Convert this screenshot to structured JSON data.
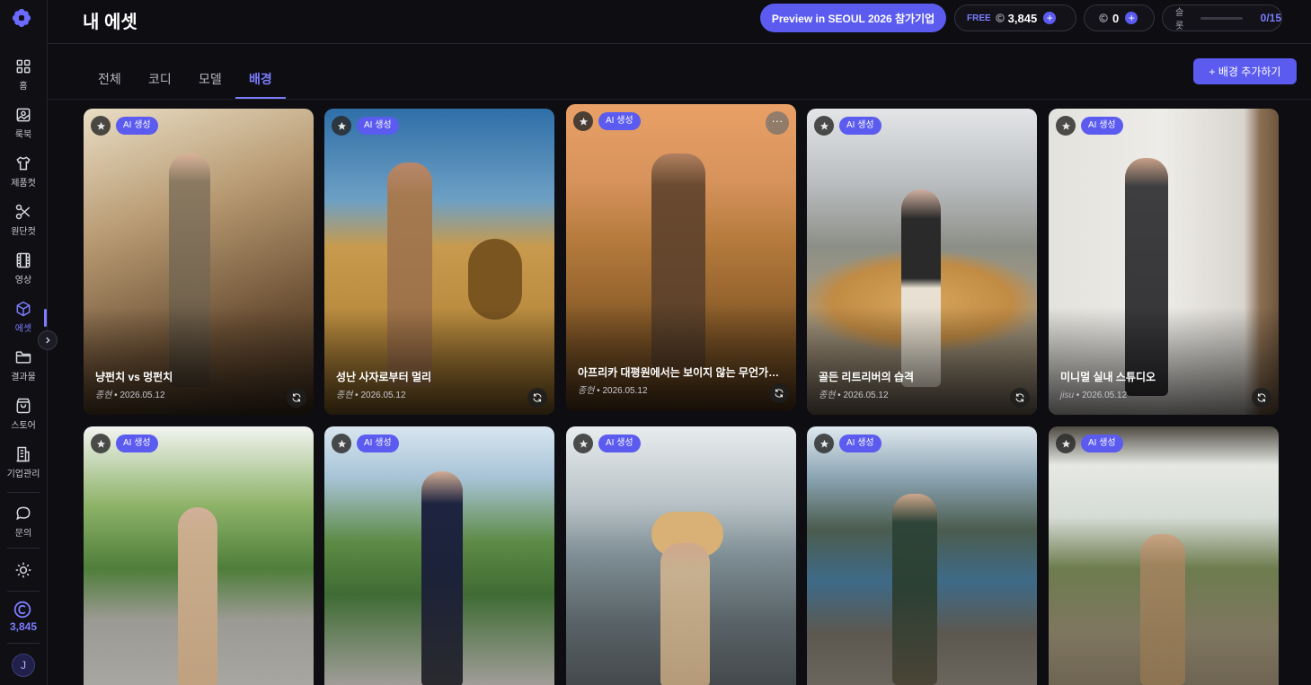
{
  "header": {
    "title": "내 에셋",
    "preview_button": "Preview in SEOUL 2026 참가기업",
    "free_tag": "FREE",
    "free_credits": "3,845",
    "zero_credits": "0",
    "slot_label": "슬롯",
    "slot_value": "0/15"
  },
  "sidebar": {
    "items": [
      {
        "label": "홈",
        "icon": "grid-icon"
      },
      {
        "label": "룩북",
        "icon": "image-icon"
      },
      {
        "label": "제품컷",
        "icon": "shirt-icon"
      },
      {
        "label": "원단컷",
        "icon": "scissors-icon"
      },
      {
        "label": "영상",
        "icon": "film-icon"
      },
      {
        "label": "에셋",
        "icon": "box-icon"
      },
      {
        "label": "결과물",
        "icon": "folder-icon"
      },
      {
        "label": "스토어",
        "icon": "bag-icon"
      },
      {
        "label": "기업관리",
        "icon": "building-icon"
      },
      {
        "label": "문의",
        "icon": "chat-icon"
      }
    ],
    "credits": "3,845",
    "avatar_initial": "J"
  },
  "tabs": [
    {
      "label": "전체"
    },
    {
      "label": "코디"
    },
    {
      "label": "모델"
    },
    {
      "label": "배경"
    }
  ],
  "add_button": "+ 배경 추가하기",
  "cards": [
    {
      "badge": "AI 생성",
      "title": "냥펀치 vs 멍펀치",
      "author": "종현",
      "date": "2026.05.12"
    },
    {
      "badge": "AI 생성",
      "title": "성난 사자로부터 멀리",
      "author": "종현",
      "date": "2026.05.12"
    },
    {
      "badge": "AI 생성",
      "title": "아프리카 대평원에서는 보이지 않는 무언가를 ...",
      "author": "종현",
      "date": "2026.05.12",
      "more": "···"
    },
    {
      "badge": "AI 생성",
      "title": "골든 리트리버의 습격",
      "author": "종현",
      "date": "2026.05.12"
    },
    {
      "badge": "AI 생성",
      "title": "미니멀 실내 스튜디오",
      "author": "jisu",
      "date": "2026.05.12"
    },
    {
      "badge": "AI 생성"
    },
    {
      "badge": "AI 생성"
    },
    {
      "badge": "AI 생성"
    },
    {
      "badge": "AI 생성"
    },
    {
      "badge": "AI 생성"
    }
  ],
  "colors": {
    "accent": "#5b5bf0",
    "accent_text": "#7c7cff",
    "background": "#0d0d12"
  }
}
